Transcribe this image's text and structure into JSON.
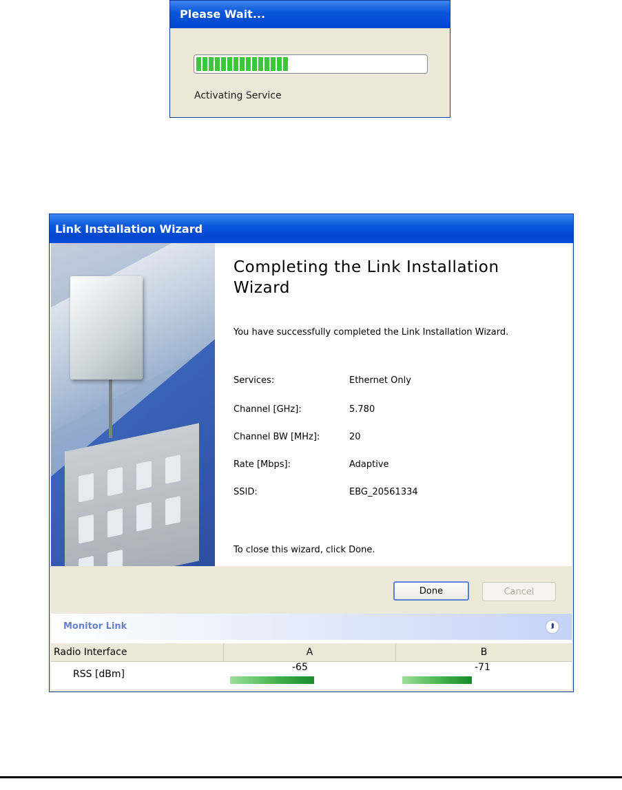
{
  "please_wait": {
    "title": "Please Wait...",
    "status": "Activating Service",
    "progress_fraction": 0.4
  },
  "wizard": {
    "title": "Link Installation Wizard",
    "heading": "Completing the Link Installation Wizard",
    "success_message": "You have successfully completed the Link Installation  Wizard.",
    "info": [
      {
        "label": "Services:",
        "value": "Ethernet Only"
      },
      {
        "label": "Channel [GHz]:",
        "value": "5.780"
      },
      {
        "label": "Channel BW [MHz]:",
        "value": "20"
      },
      {
        "label": "Rate [Mbps]:",
        "value": "Adaptive"
      },
      {
        "label": "SSID:",
        "value": "EBG_20561334"
      }
    ],
    "close_note": "To close this wizard, click Done.",
    "buttons": {
      "done": "Done",
      "cancel": "Cancel"
    }
  },
  "monitor": {
    "title": "Monitor Link",
    "columns": [
      "Radio Interface",
      "A",
      "B"
    ],
    "rows": [
      {
        "label": "RSS [dBm]",
        "a_value": "-65",
        "b_value": "-71",
        "a_fraction": 0.52,
        "b_fraction": 0.43
      }
    ]
  },
  "colors": {
    "title_bar": "#0a55d8",
    "progress_green": "#3cc63c",
    "rss_bar_green": "#3fae48",
    "monitor_title": "#6a80c7"
  }
}
